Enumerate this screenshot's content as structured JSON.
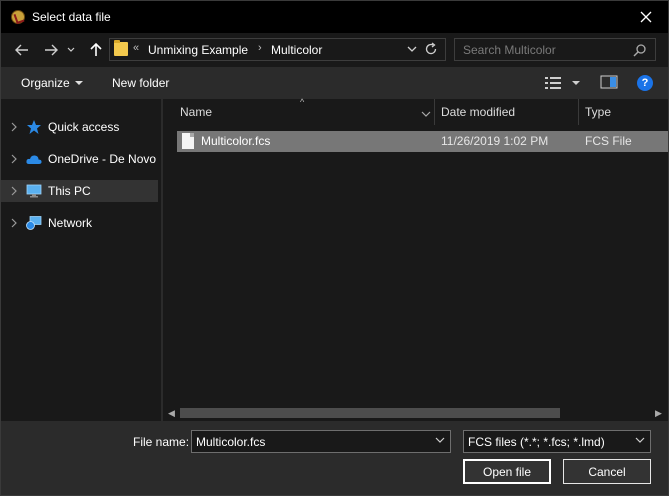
{
  "window": {
    "title": "Select data file",
    "icons": {
      "app": "app-icon",
      "close": "close-icon"
    }
  },
  "nav": {
    "icons": {
      "back": "back-arrow-icon",
      "forward": "forward-arrow-icon",
      "recent": "chevron-down-icon",
      "up": "up-arrow-icon"
    },
    "address": {
      "overflow": "«",
      "crumbs": [
        "Unmixing Example",
        "Multicolor"
      ],
      "separator": "›"
    },
    "search_placeholder": "Search Multicolor"
  },
  "toolbar": {
    "organize": "Organize",
    "new_folder": "New folder",
    "help": "?"
  },
  "sidebar": {
    "items": [
      {
        "label": "Quick access",
        "icon": "star-icon",
        "selected": false
      },
      {
        "label": "OneDrive - De Novo Software",
        "icon": "cloud-icon",
        "selected": false
      },
      {
        "label": "This PC",
        "icon": "computer-icon",
        "selected": true
      },
      {
        "label": "Network",
        "icon": "network-icon",
        "selected": false
      }
    ]
  },
  "filelist": {
    "columns": {
      "name": "Name",
      "date": "Date modified",
      "type": "Type"
    },
    "rows": [
      {
        "name": "Multicolor.fcs",
        "date": "11/26/2019 1:02 PM",
        "type": "FCS File"
      }
    ]
  },
  "footer": {
    "file_name_label": "File name:",
    "file_name_value": "Multicolor.fcs",
    "file_type_value": "FCS files (*.*; *.fcs; *.lmd)",
    "open_label": "Open file",
    "cancel_label": "Cancel"
  },
  "colors": {
    "window_bg": "#191919",
    "toolbar_bg": "#2b2b2b",
    "selected_row": "#777777",
    "help_blue": "#1a73e8",
    "folder_yellow": "#f3c94d"
  }
}
